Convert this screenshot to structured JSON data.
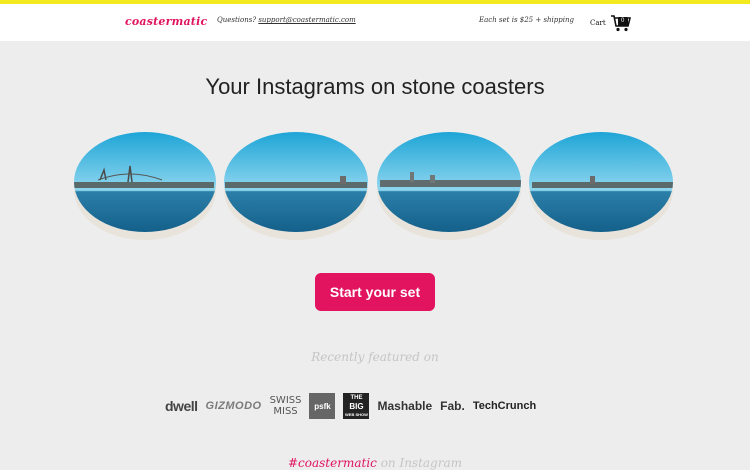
{
  "header": {
    "logo": "coastermatic",
    "questions_prefix": "Questions? ",
    "support_email": "support@coastermatic.com",
    "price_note": "Each set is $25 + shipping",
    "cart_label": "Cart",
    "cart_count": "0"
  },
  "hero": {
    "headline": "Your Instagrams on stone coasters",
    "cta_label": "Start your set"
  },
  "press": {
    "heading": "Recently featured on",
    "logos": {
      "dwell": "dwell",
      "gizmodo": "GIZMODO",
      "swiss_line1": "SWISS",
      "swiss_line2": "MISS",
      "psfk": "psfk",
      "bigweb_line1": "THE",
      "bigweb_line2": "BIG",
      "bigweb_line3": "WEB SHOW",
      "mashable": "Mashable",
      "fab": "Fab.",
      "techcrunch": "TechCrunch"
    }
  },
  "instagram": {
    "tag": "#coastermatic",
    "suffix": " on Instagram"
  },
  "colors": {
    "accent": "#e2135f",
    "topbar": "#f2e91f",
    "background": "#ededed"
  }
}
